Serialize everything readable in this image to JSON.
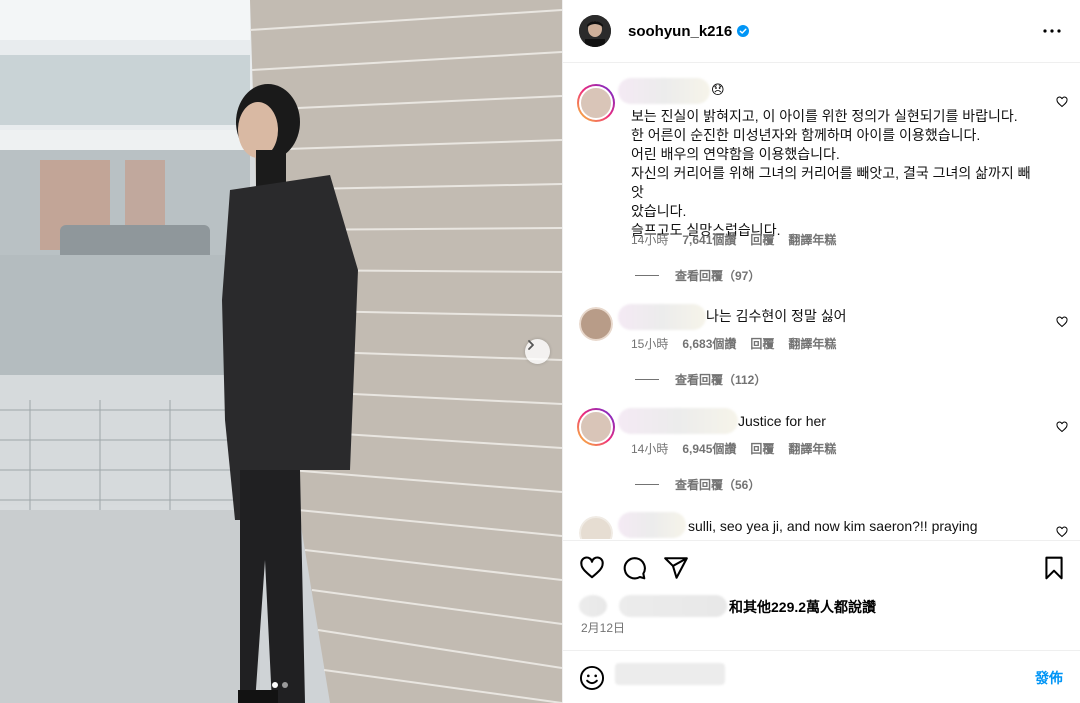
{
  "post": {
    "username": "soohyun_k216",
    "verified_icon": "verified-badge-icon",
    "more_icon": "more-horizontal-icon"
  },
  "photo": {
    "next_icon": "chevron-right-icon",
    "carousel_dots": 2,
    "active_dot": 1
  },
  "comments": [
    {
      "emoji": "😞",
      "text": "보는 진실이 밝혀지고, 이 아이를 위한 정의가 실현되기를 바랍니다.\n한 어른이 순진한 미성년자와 함께하며 아이를 이용했습니다.\n어린 배우의 연약함을 이용했습니다.\n자신의 커리어를 위해 그녀의 커리어를 빼앗고, 결국 그녀의 삶까지 빼앗\n았습니다.\n슬프고도 실망스럽습니다.",
      "time": "14小時",
      "likes": "7,641個讚",
      "reply": "回覆",
      "translate": "翻譯年糕",
      "view_replies": "查看回覆（97）"
    },
    {
      "text": "나는 김수현이 정말 싫어",
      "time": "15小時",
      "likes": "6,683個讚",
      "reply": "回覆",
      "translate": "翻譯年糕",
      "view_replies": "查看回覆（112）"
    },
    {
      "text": "Justice for her",
      "time": "14小時",
      "likes": "6,945個讚",
      "reply": "回覆",
      "translate": "翻譯年糕",
      "view_replies": "查看回覆（56）"
    },
    {
      "text": "sulli, seo yea ji, and now kim saeron?!! praying"
    }
  ],
  "actions": {
    "like_icon": "heart-icon",
    "comment_icon": "comment-bubble-icon",
    "share_icon": "send-icon",
    "save_icon": "bookmark-icon"
  },
  "likes_summary": "和其他229.2萬人都說讚",
  "date": "2月12日",
  "composer": {
    "emoji_icon": "smiley-icon",
    "placeholder": "",
    "post_label": "發佈"
  }
}
